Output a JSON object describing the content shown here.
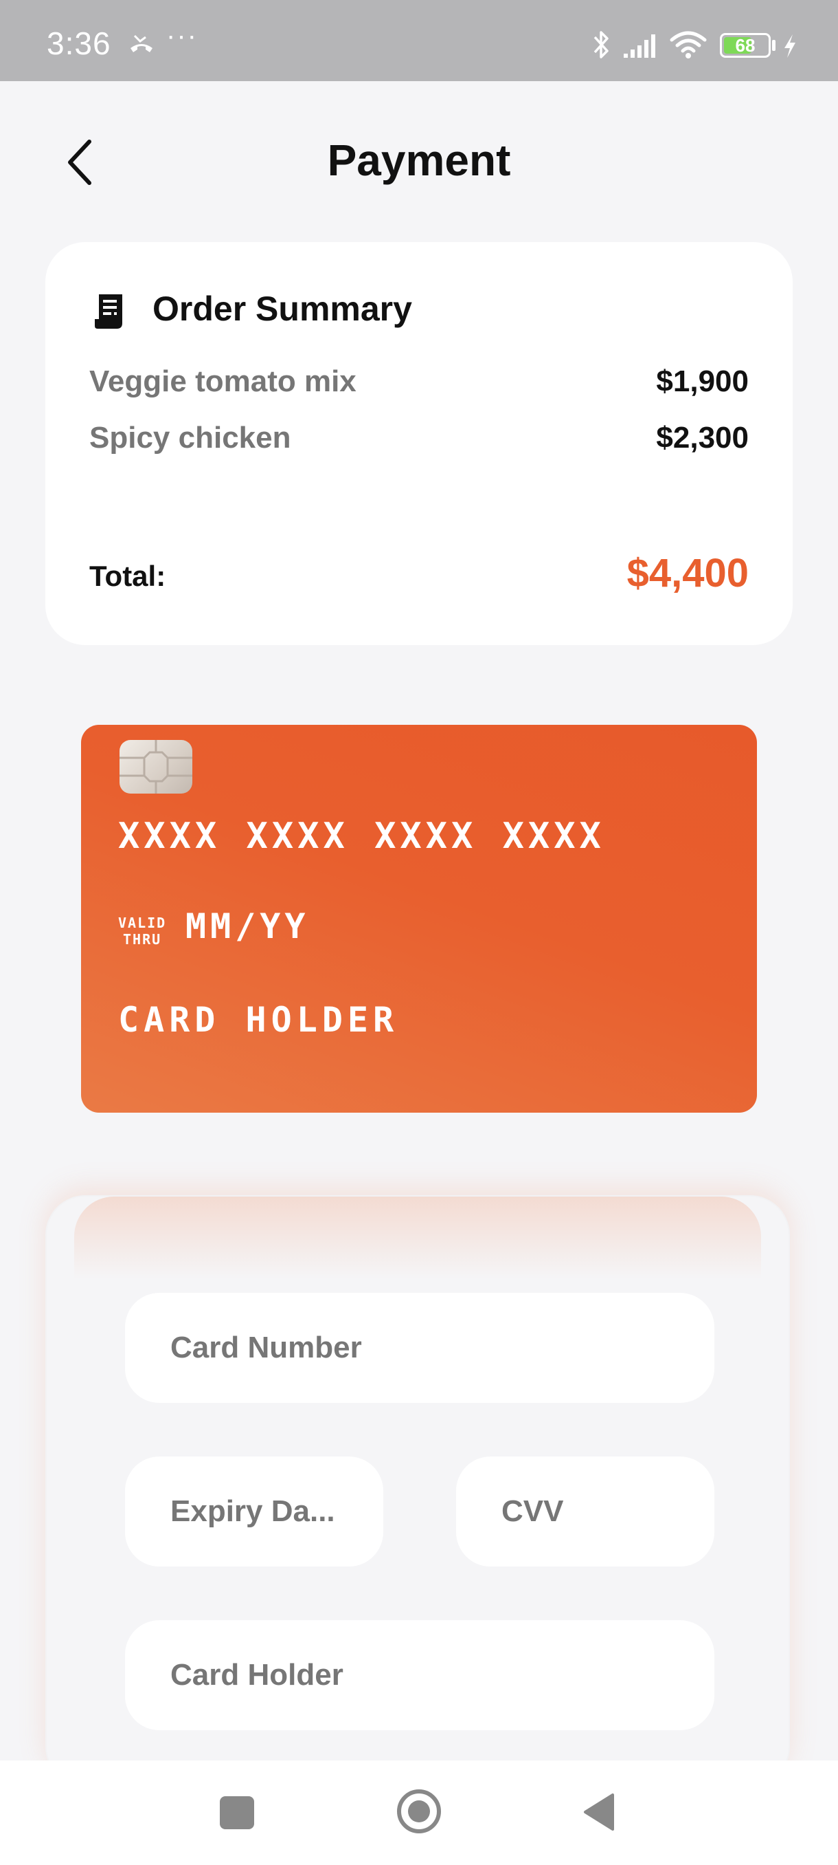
{
  "status_bar": {
    "time": "3:36",
    "more": "···",
    "battery_level": "68",
    "battery_fraction": 0.68,
    "icons": [
      "missed-call-icon",
      "bluetooth-icon",
      "signal-icon",
      "wifi-icon",
      "battery-icon",
      "charging-icon"
    ]
  },
  "header": {
    "title": "Payment",
    "back_icon": "chevron-left-icon"
  },
  "order_summary": {
    "title": "Order Summary",
    "icon": "receipt-icon",
    "items": [
      {
        "name": "Veggie tomato mix",
        "price": "$1,900"
      },
      {
        "name": "Spicy chicken",
        "price": "$2,300"
      }
    ],
    "total_label": "Total:",
    "total_value": "$4,400"
  },
  "card_preview": {
    "number": "XXXX XXXX XXXX XXXX",
    "valid_thru_line1": "VALID",
    "valid_thru_line2": "THRU",
    "expiry": "MM/YY",
    "holder": "CARD HOLDER"
  },
  "form": {
    "card_number_placeholder": "Card Number",
    "expiry_placeholder": "Expiry Da...",
    "cvv_placeholder": "CVV",
    "card_holder_placeholder": "Card Holder"
  },
  "nav_bar": {
    "icons": [
      "recents-icon",
      "home-icon",
      "back-icon"
    ]
  },
  "colors": {
    "accent": "#e85f2e",
    "card_gradient_start": "#ea7a45",
    "card_gradient_end": "#e75a2b",
    "background": "#f5f5f7",
    "muted_text": "#767676",
    "status_bar": "#b5b5b7"
  }
}
